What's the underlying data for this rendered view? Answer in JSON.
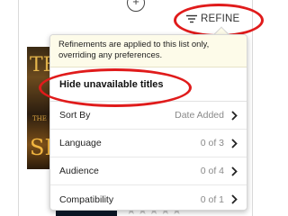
{
  "toolbar": {
    "refine_label": "REFINE",
    "refine_icon": "filter-lines-icon",
    "add_icon": "circle-plus-icon"
  },
  "background": {
    "cover_top_letters": "TE",
    "cover_top_sub": "THE",
    "cover_top_big": "SH",
    "rating_stars": "★★★★★"
  },
  "refine_menu": {
    "notice": "Refinements are applied to this list only, overriding any preferences.",
    "hide_unavailable_label": "Hide unavailable titles",
    "rows": [
      {
        "label": "Sort By",
        "value": "Date Added"
      },
      {
        "label": "Language",
        "value": "0 of 3"
      },
      {
        "label": "Audience",
        "value": "0 of 4"
      },
      {
        "label": "Compatibility",
        "value": "0 of 1"
      }
    ]
  },
  "colors": {
    "annotation_red": "#e01b1b",
    "notice_background": "#fdfbe9",
    "value_gray": "#8a8a8a"
  }
}
